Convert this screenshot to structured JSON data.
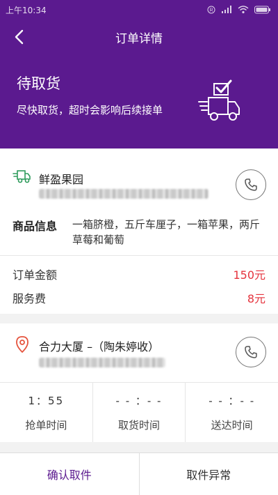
{
  "status_bar": {
    "time": "上午10:34"
  },
  "nav": {
    "title": "订单详情"
  },
  "order_state": {
    "title": "待取货",
    "subtitle": "尽快取货，超时会影响后续接单"
  },
  "shop": {
    "name": "鲜盈果园",
    "goods_label": "商品信息",
    "goods": "一箱脐橙，五斤车厘子，一箱苹果，两斤草莓和葡萄"
  },
  "amounts": {
    "order_amount_label": "订单金额",
    "order_amount": "150元",
    "service_fee_label": "服务费",
    "service_fee": "8元"
  },
  "destination": {
    "name": "合力大厦 –（陶朱婷收）"
  },
  "times": [
    {
      "value": "1：55",
      "label": "抢单时间"
    },
    {
      "value": "- - ：- -",
      "label": "取货时间"
    },
    {
      "value": "- - ：- -",
      "label": "送达时间"
    }
  ],
  "actions": {
    "confirm": "确认取件",
    "exception": "取件异常"
  },
  "colors": {
    "brand": "#5b1a8f",
    "price": "#e5333d"
  }
}
